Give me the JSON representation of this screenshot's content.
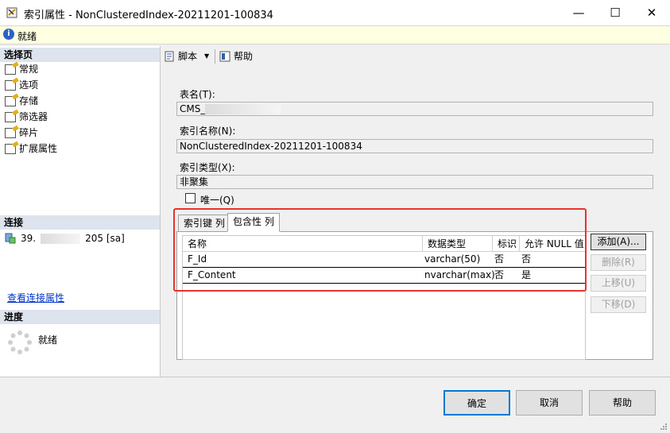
{
  "window": {
    "title": "索引属性 - NonClusteredIndex-20211201-100834",
    "minimize_glyph": "—",
    "maximize_glyph": "☐",
    "close_glyph": "✕"
  },
  "infobar": {
    "status": "就绪"
  },
  "left": {
    "select_page_header": "选择页",
    "pages": [
      {
        "label": "常规"
      },
      {
        "label": "选项"
      },
      {
        "label": "存储"
      },
      {
        "label": "筛选器"
      },
      {
        "label": "碎片"
      },
      {
        "label": "扩展属性"
      }
    ],
    "connection_header": "连接",
    "connection_text_a": "39.",
    "connection_text_b": "205 [sa]",
    "view_connection_link": "查看连接属性",
    "progress_header": "进度",
    "progress_status": "就绪"
  },
  "toolbar": {
    "script_label": "脚本",
    "help_label": "帮助"
  },
  "form": {
    "table_name_label": "表名(T):",
    "table_name_value": "CMS_",
    "index_name_label": "索引名称(N):",
    "index_name_value": "NonClusteredIndex-20211201-100834",
    "index_type_label": "索引类型(X):",
    "index_type_value": "非聚集",
    "unique_label": "唯一(Q)"
  },
  "tabs": [
    {
      "label": "索引键 列"
    },
    {
      "label": "包含性 列"
    }
  ],
  "grid": {
    "headers": [
      "名称",
      "数据类型",
      "标识",
      "允许 NULL 值"
    ],
    "rows": [
      [
        "F_Id",
        "varchar(50)",
        "否",
        "否"
      ],
      [
        "F_Content",
        "nvarchar(max)",
        "否",
        "是"
      ]
    ]
  },
  "side_buttons": {
    "add": "添加(A)...",
    "delete": "删除(R)",
    "up": "上移(U)",
    "down": "下移(D)"
  },
  "buttons": {
    "ok": "确定",
    "cancel": "取消",
    "help": "帮助"
  },
  "colors": {
    "highlight_box": "#e8322b",
    "info_bar": "#ffffe1",
    "section_header": "#dde4ee"
  }
}
